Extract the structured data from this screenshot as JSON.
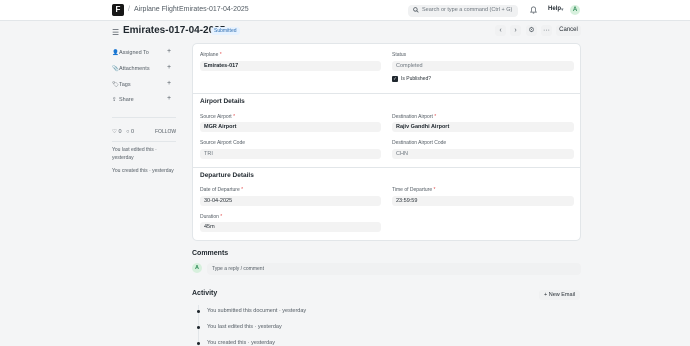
{
  "navbar": {
    "logo_letter": "F",
    "breadcrumb_1": "Airplane Flight",
    "breadcrumb_sep_1": "/",
    "breadcrumb_sep_2": "/",
    "breadcrumb_2": "Emirates-017-04-2025",
    "search_placeholder": "Search or type a command (Ctrl + G)",
    "help_label": "Help",
    "avatar_letter": "A"
  },
  "header": {
    "title": "Emirates-017-04-2025",
    "status_badge": "Submitted",
    "prev_icon": "‹",
    "next_icon": "›",
    "settings_icon": "⚙",
    "more_icon": "···",
    "cancel_label": "Cancel"
  },
  "sidebar": {
    "assigned_to": "Assigned To",
    "attachments": "Attachments",
    "tags": "Tags",
    "share": "Share",
    "likes_count": "0",
    "comments_count": "0",
    "follow_label": "FOLLOW",
    "last_edited": "You last edited this · yesterday",
    "created": "You created this · yesterday"
  },
  "form": {
    "airplane_label": "Airplane",
    "airplane_value": "Emirates-017",
    "status_label": "Status",
    "status_value": "Completed",
    "is_published_label": "Is Published?",
    "airport_section": "Airport Details",
    "source_airport_label": "Source Airport",
    "source_airport_value": "MGR Airport",
    "destination_airport_label": "Destination Airport",
    "destination_airport_value": "Rajiv Gandhi Airport",
    "source_code_label": "Source Airport Code",
    "source_code_value": "TRI",
    "destination_code_label": "Destination Airport Code",
    "destination_code_value": "CHN",
    "departure_section": "Departure Details",
    "date_label": "Date of Departure",
    "date_value": "30-04-2025",
    "time_label": "Time of Departure",
    "time_value": "23:59:59",
    "duration_label": "Duration",
    "duration_value": "45m"
  },
  "comments": {
    "title": "Comments",
    "avatar_letter": "A",
    "placeholder": "Type a reply / comment"
  },
  "activity": {
    "title": "Activity",
    "new_email_label": "+ New Email",
    "items": [
      "You submitted this document · yesterday",
      "You last edited this · yesterday",
      "You created this · yesterday"
    ]
  }
}
